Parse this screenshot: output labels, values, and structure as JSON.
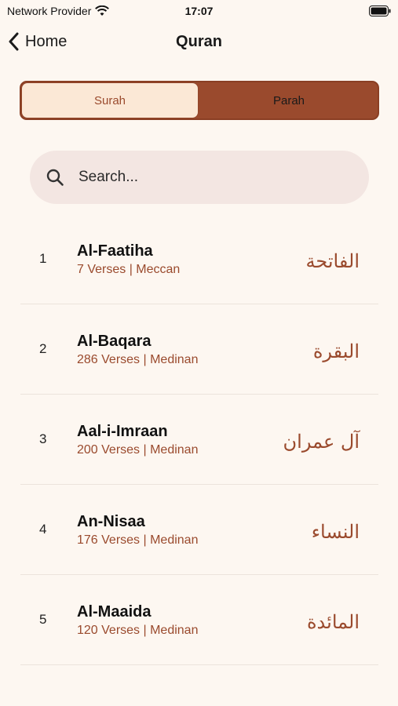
{
  "status_bar": {
    "carrier": "Network Provider",
    "time": "17:07"
  },
  "nav": {
    "back_label": "Home",
    "title": "Quran"
  },
  "segments": {
    "left": "Surah",
    "right": "Parah",
    "selected": "Surah"
  },
  "search": {
    "placeholder": "Search..."
  },
  "colors": {
    "accent": "#9a4a2d",
    "background": "#fdf7f1",
    "selected_segment": "#fbe8d6",
    "search_bg": "#f3e6e2"
  },
  "surahs": [
    {
      "number": "1",
      "name": "Al-Faatiha",
      "meta": "7 Verses | Meccan",
      "arabic": "الفاتحة"
    },
    {
      "number": "2",
      "name": "Al-Baqara",
      "meta": "286 Verses | Medinan",
      "arabic": "البقرة"
    },
    {
      "number": "3",
      "name": "Aal-i-Imraan",
      "meta": "200 Verses | Medinan",
      "arabic": "آل عمران"
    },
    {
      "number": "4",
      "name": "An-Nisaa",
      "meta": "176 Verses | Medinan",
      "arabic": "النساء"
    },
    {
      "number": "5",
      "name": "Al-Maaida",
      "meta": "120 Verses | Medinan",
      "arabic": "المائدة"
    }
  ]
}
